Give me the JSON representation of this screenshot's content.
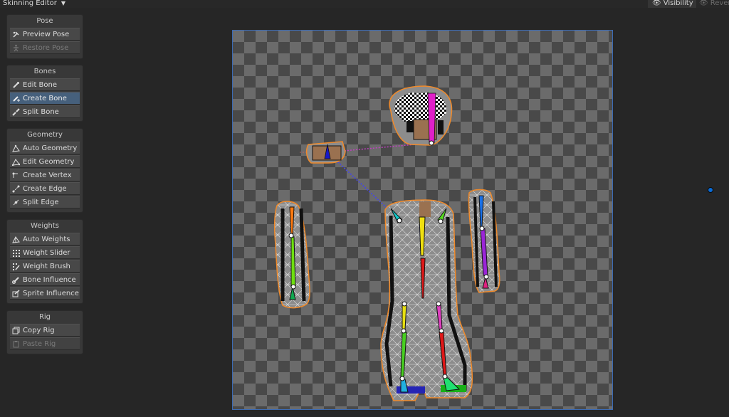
{
  "toolbar": {
    "mode_label": "Skinning Editor",
    "visibility_label": "Visibility",
    "reveal_label": "Rever"
  },
  "panels": {
    "pose": {
      "title": "Pose",
      "buttons": [
        {
          "label": "Preview Pose",
          "icon": "preview-pose-icon",
          "state": "normal"
        },
        {
          "label": "Restore Pose",
          "icon": "restore-pose-icon",
          "state": "disabled"
        }
      ]
    },
    "bones": {
      "title": "Bones",
      "buttons": [
        {
          "label": "Edit Bone",
          "icon": "edit-bone-icon",
          "state": "normal"
        },
        {
          "label": "Create Bone",
          "icon": "create-bone-icon",
          "state": "active"
        },
        {
          "label": "Split Bone",
          "icon": "split-bone-icon",
          "state": "normal"
        }
      ]
    },
    "geometry": {
      "title": "Geometry",
      "buttons": [
        {
          "label": "Auto Geometry",
          "icon": "auto-geometry-icon",
          "state": "normal"
        },
        {
          "label": "Edit Geometry",
          "icon": "edit-geometry-icon",
          "state": "normal"
        },
        {
          "label": "Create Vertex",
          "icon": "create-vertex-icon",
          "state": "normal"
        },
        {
          "label": "Create Edge",
          "icon": "create-edge-icon",
          "state": "normal"
        },
        {
          "label": "Split Edge",
          "icon": "split-edge-icon",
          "state": "normal"
        }
      ]
    },
    "weights": {
      "title": "Weights",
      "buttons": [
        {
          "label": "Auto Weights",
          "icon": "auto-weights-icon",
          "state": "normal"
        },
        {
          "label": "Weight Slider",
          "icon": "weight-slider-icon",
          "state": "normal"
        },
        {
          "label": "Weight Brush",
          "icon": "weight-brush-icon",
          "state": "normal"
        },
        {
          "label": "Bone Influence",
          "icon": "bone-influence-icon",
          "state": "normal"
        },
        {
          "label": "Sprite Influence",
          "icon": "sprite-influence-icon",
          "state": "normal"
        }
      ]
    },
    "rig": {
      "title": "Rig",
      "buttons": [
        {
          "label": "Copy Rig",
          "icon": "copy-rig-icon",
          "state": "normal"
        },
        {
          "label": "Paste Rig",
          "icon": "paste-rig-icon",
          "state": "disabled"
        }
      ]
    }
  },
  "colors": {
    "accent": "#46607c",
    "outline": "#f08a2a",
    "canvas_border": "#3d6bb3"
  }
}
